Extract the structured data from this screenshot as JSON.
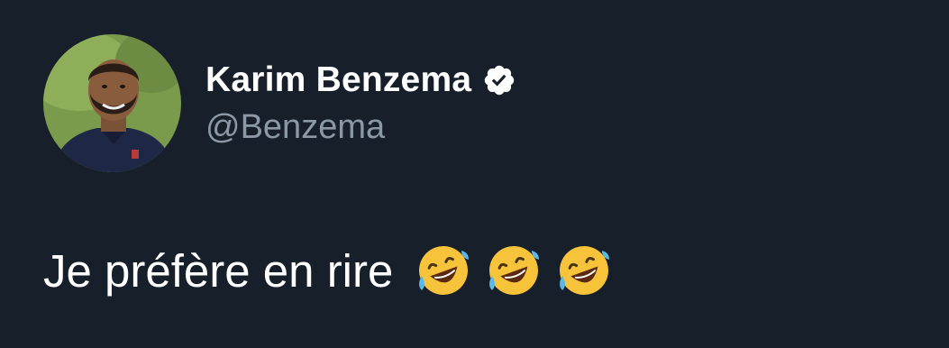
{
  "author": {
    "display_name": "Karim Benzema",
    "handle": "@Benzema",
    "verified": true
  },
  "tweet": {
    "text": "Je préfère en rire",
    "emojis": [
      "rolling-on-floor-laughing",
      "rolling-on-floor-laughing",
      "rolling-on-floor-laughing"
    ]
  },
  "icons": {
    "verified": "verified-badge-icon",
    "avatar": "profile-photo"
  },
  "colors": {
    "background": "#161f2a",
    "name": "#ffffff",
    "handle": "#8b98a5",
    "text": "#ffffff",
    "emoji_face": "#f7c33b",
    "emoji_tear": "#5ab8e8"
  }
}
